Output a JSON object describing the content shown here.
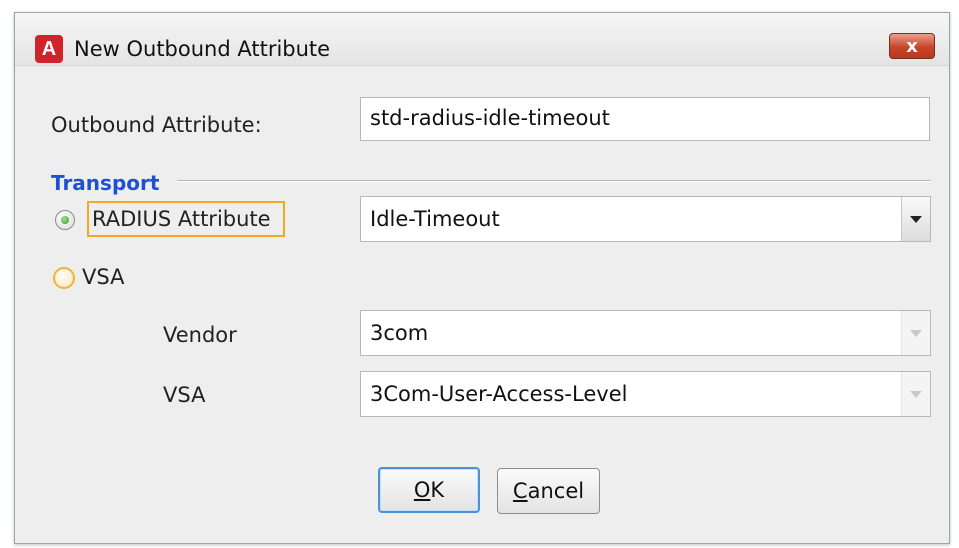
{
  "window": {
    "title": "New Outbound Attribute",
    "app_icon_letter": "A",
    "close_label": "x"
  },
  "form": {
    "outbound_label": "Outbound Attribute:",
    "outbound_value": "std-radius-idle-timeout",
    "section_title": "Transport",
    "radius_option": {
      "label": "RADIUS Attribute",
      "selected": true,
      "value": "Idle-Timeout"
    },
    "vsa_option": {
      "label": "VSA",
      "selected": false
    },
    "vendor": {
      "label": "Vendor",
      "value": "3com",
      "enabled": false
    },
    "vsa": {
      "label": "VSA",
      "value": "3Com-User-Access-Level",
      "enabled": false
    }
  },
  "buttons": {
    "ok": {
      "mnemonic": "O",
      "rest": "K"
    },
    "cancel": {
      "mnemonic": "C",
      "rest": "ancel"
    }
  },
  "colors": {
    "section_title": "#1f4fd6",
    "focus_outline": "#f0a826",
    "close_button": "#c8452a",
    "app_icon": "#d0232a"
  }
}
